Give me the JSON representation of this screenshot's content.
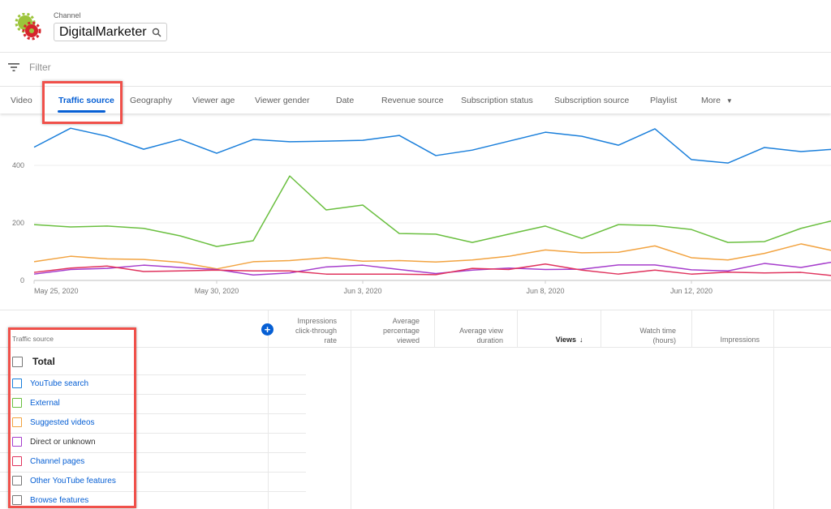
{
  "header": {
    "channel_label": "Channel",
    "channel_name": "DigitalMarketer",
    "search_icon": "search-icon"
  },
  "filter": {
    "placeholder": "Filter",
    "icon": "filter-icon"
  },
  "tabs": [
    "Video",
    "Traffic source",
    "Geography",
    "Viewer age",
    "Viewer gender",
    "Date",
    "Revenue source",
    "Subscription status",
    "Subscription source",
    "Playlist",
    "More"
  ],
  "active_tab": "Traffic source",
  "annotation_color": "#f0504a",
  "chart_data": {
    "type": "line",
    "x": [
      "May 24, 2020",
      "May 25, 2020",
      "May 26, 2020",
      "May 27, 2020",
      "May 28, 2020",
      "May 29, 2020",
      "May 30, 2020",
      "May 31, 2020",
      "Jun 1, 2020",
      "Jun 2, 2020",
      "Jun 3, 2020",
      "Jun 4, 2020",
      "Jun 5, 2020",
      "Jun 6, 2020",
      "Jun 7, 2020",
      "Jun 8, 2020",
      "Jun 9, 2020",
      "Jun 10, 2020",
      "Jun 11, 2020",
      "Jun 12, 2020",
      "Jun 13, 2020",
      "Jun 14, 2020",
      "Jun 15, 2020"
    ],
    "x_tick_labels": [
      "May 25, 2020",
      "May 30, 2020",
      "Jun 3, 2020",
      "Jun 8, 2020",
      "Jun 12, 2020"
    ],
    "y_tick_labels": [
      "0",
      "200",
      "400"
    ],
    "ylim": [
      0,
      400
    ],
    "grid": true,
    "series": [
      {
        "color": "#1a7fdb",
        "values": [
          463,
          529,
          501,
          456,
          490,
          442,
          490,
          482,
          484,
          487,
          504,
          434,
          453,
          484,
          515,
          501,
          470,
          527,
          420,
          408,
          462,
          448,
          457
        ]
      },
      {
        "color": "#6abf3f",
        "values": [
          194,
          186,
          189,
          181,
          155,
          118,
          138,
          363,
          245,
          262,
          163,
          161,
          132,
          161,
          189,
          146,
          194,
          191,
          177,
          132,
          135,
          181,
          212
        ]
      },
      {
        "color": "#f2a340",
        "values": [
          65,
          84,
          75,
          73,
          63,
          40,
          65,
          69,
          79,
          67,
          69,
          64,
          71,
          84,
          106,
          96,
          98,
          120,
          79,
          71,
          94,
          127,
          100
        ]
      },
      {
        "color": "#a63dcc",
        "values": [
          22,
          38,
          42,
          53,
          45,
          38,
          19,
          26,
          47,
          53,
          38,
          24,
          36,
          43,
          38,
          39,
          54,
          54,
          37,
          33,
          59,
          45,
          67
        ]
      },
      {
        "color": "#e0345e",
        "values": [
          28,
          43,
          50,
          31,
          33,
          36,
          33,
          33,
          22,
          22,
          22,
          20,
          42,
          38,
          57,
          36,
          22,
          36,
          22,
          29,
          26,
          28,
          15
        ]
      }
    ]
  },
  "table": {
    "add_column_icon": "plus-circle-icon",
    "columns": [
      "Impressions click-through rate",
      "Average percentage viewed",
      "Average view duration",
      "Views",
      "Watch time (hours)",
      "Impressions"
    ],
    "column_lines": [
      [
        "Impressions",
        "click-through",
        "rate"
      ],
      [
        "Average",
        "percentage",
        "viewed"
      ],
      [
        "Average view",
        "duration"
      ],
      [
        "Views"
      ],
      [
        "Watch time",
        "(hours)"
      ],
      [
        "Impressions"
      ]
    ],
    "sorted_column": "Views",
    "first_col_header": "Traffic source",
    "rows": [
      {
        "label": "Total",
        "color": "#777777"
      },
      {
        "label": "YouTube search",
        "color": "#1a7fdb"
      },
      {
        "label": "External",
        "color": "#6abf3f"
      },
      {
        "label": "Suggested videos",
        "color": "#f2a340"
      },
      {
        "label": "Direct or unknown",
        "color": "#a63dcc"
      },
      {
        "label": "Channel pages",
        "color": "#e0345e"
      },
      {
        "label": "Other YouTube features",
        "color": "#777777"
      },
      {
        "label": "Browse features",
        "color": "#777777"
      }
    ]
  }
}
